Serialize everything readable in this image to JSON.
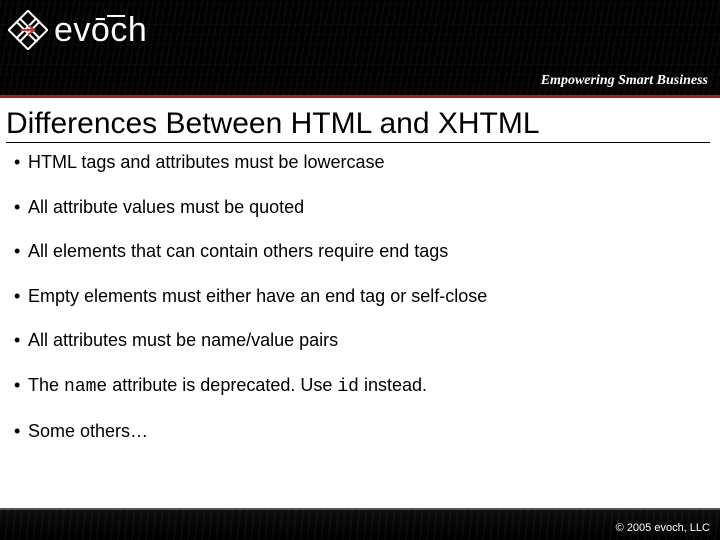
{
  "header": {
    "brand": "evōch",
    "tagline": "Empowering Smart Business"
  },
  "slide": {
    "title": "Differences Between HTML and XHTML",
    "bullets": [
      {
        "text": "HTML tags and attributes must be lowercase"
      },
      {
        "text": "All attribute values must be quoted"
      },
      {
        "text": "All elements that can contain others require end tags"
      },
      {
        "text": "Empty elements must either have an end tag or self-close"
      },
      {
        "text": "All attributes must be name/value pairs"
      },
      {
        "pre": "The ",
        "code1": "name",
        "mid": " attribute is deprecated.  Use ",
        "code2": "id",
        "post": " instead."
      },
      {
        "text": "Some others…"
      }
    ]
  },
  "footer": {
    "copyright": "© 2005  evoch, LLC"
  }
}
